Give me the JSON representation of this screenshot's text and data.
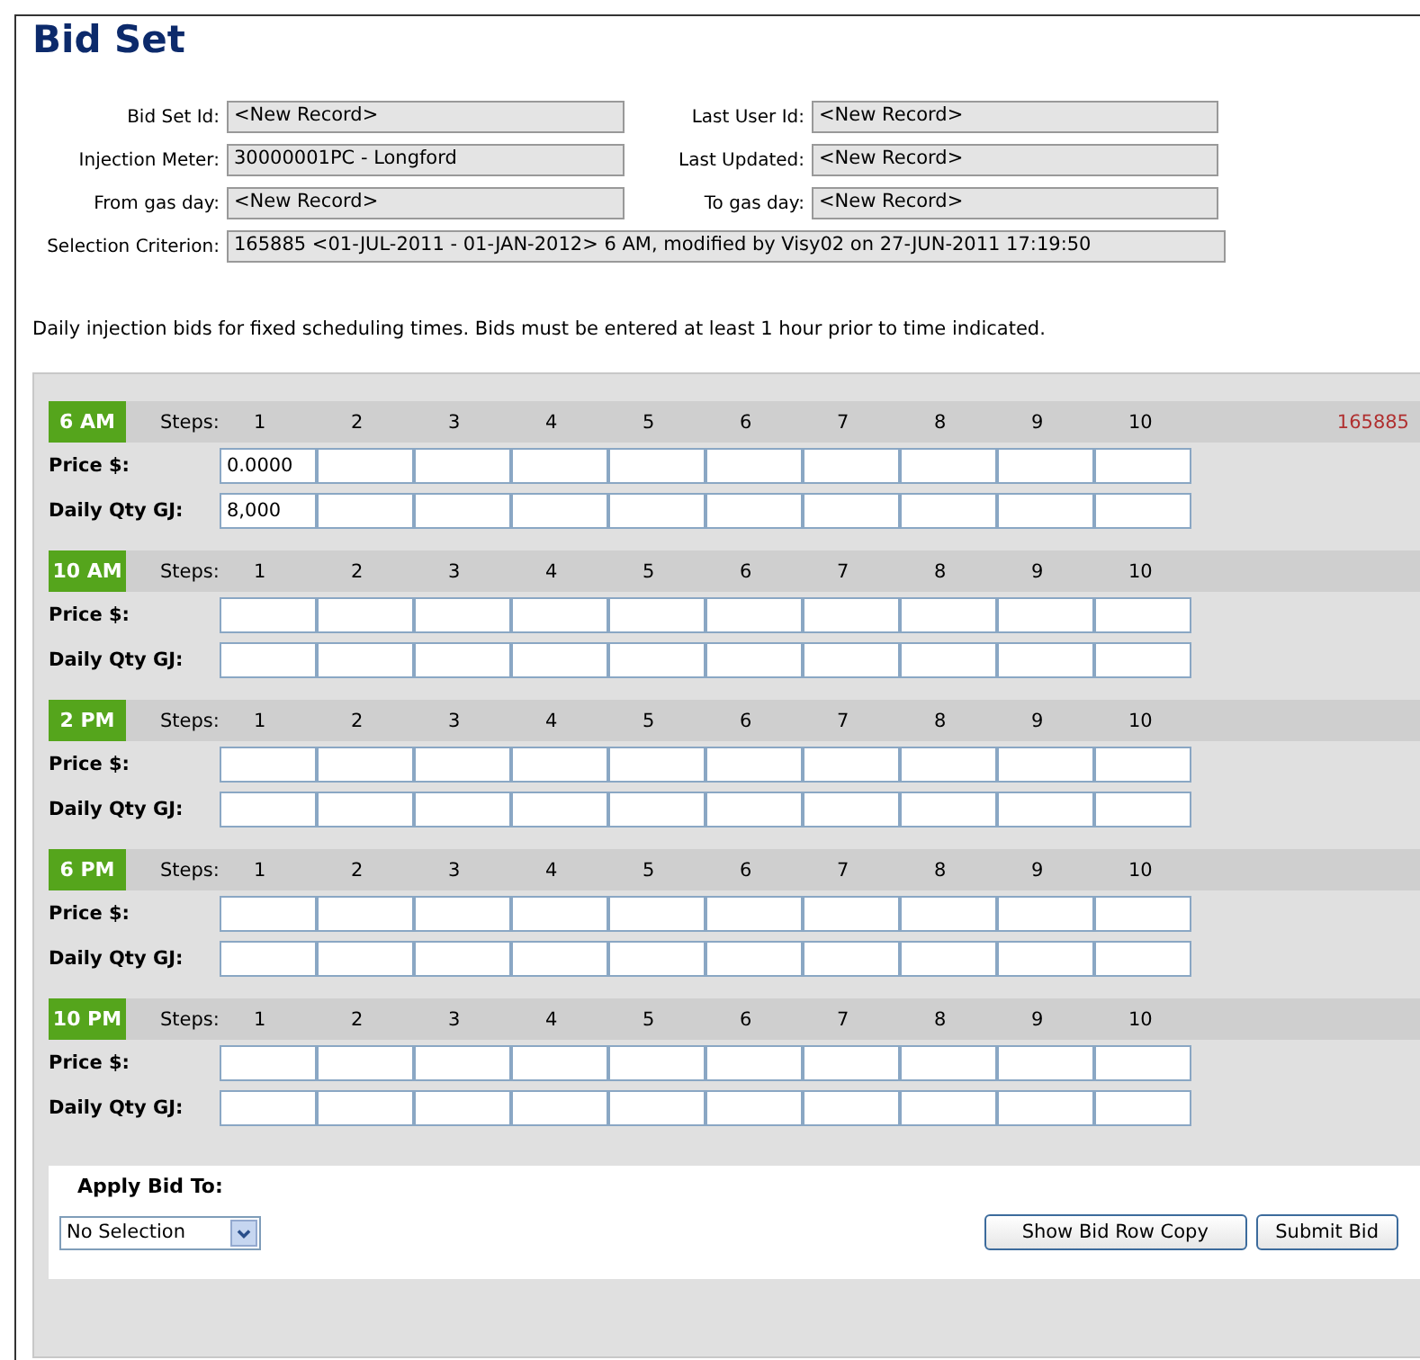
{
  "title": "Bid Set",
  "fields": [
    {
      "label": "Bid Set Id:",
      "value": "<New Record>"
    },
    {
      "label": "Last User Id:",
      "value": "<New Record>"
    },
    {
      "label": "Injection Meter:",
      "value": "30000001PC - Longford"
    },
    {
      "label": "Last Updated:",
      "value": "<New Record>"
    },
    {
      "label": "From gas day:",
      "value": "<New Record>"
    },
    {
      "label": "To gas day:",
      "value": "<New Record>"
    }
  ],
  "selection_criterion": {
    "label": "Selection Criterion:",
    "value": "165885 <01-JUL-2011 - 01-JAN-2012> 6 AM, modified by Visy02 on 27-JUN-2011 17:19:50"
  },
  "description": "Daily injection bids for fixed scheduling times. Bids must be entered at least 1 hour prior to time indicated.",
  "sections": [
    {
      "time": "6 AM",
      "steps_label": "Steps:",
      "steps": [
        "1",
        "2",
        "3",
        "4",
        "5",
        "6",
        "7",
        "8",
        "9",
        "10"
      ],
      "reference": "165885",
      "price_label": "Price $:",
      "price_values": [
        "0.0000"
      ],
      "qty_label": "Daily Qty GJ:",
      "qty_values": [
        "8,000"
      ]
    },
    {
      "time": "10 AM",
      "steps_label": "Steps:",
      "steps": [
        "1",
        "2",
        "3",
        "4",
        "5",
        "6",
        "7",
        "8",
        "9",
        "10"
      ],
      "price_label": "Price $:",
      "qty_label": "Daily Qty GJ:"
    },
    {
      "time": "2 PM",
      "steps_label": "Steps:",
      "steps": [
        "1",
        "2",
        "3",
        "4",
        "5",
        "6",
        "7",
        "8",
        "9",
        "10"
      ],
      "price_label": "Price $:",
      "qty_label": "Daily Qty GJ:"
    },
    {
      "time": "6 PM",
      "steps_label": "Steps:",
      "steps": [
        "1",
        "2",
        "3",
        "4",
        "5",
        "6",
        "7",
        "8",
        "9",
        "10"
      ],
      "price_label": "Price $:",
      "qty_label": "Daily Qty GJ:"
    },
    {
      "time": "10 PM",
      "steps_label": "Steps:",
      "steps": [
        "1",
        "2",
        "3",
        "4",
        "5",
        "6",
        "7",
        "8",
        "9",
        "10"
      ],
      "price_label": "Price $:",
      "qty_label": "Daily Qty GJ:"
    }
  ],
  "apply": {
    "label": "Apply Bid To:",
    "dropdown": "No Selection"
  },
  "buttons": [
    "Show Bid Row Copy",
    "Submit Bid"
  ]
}
